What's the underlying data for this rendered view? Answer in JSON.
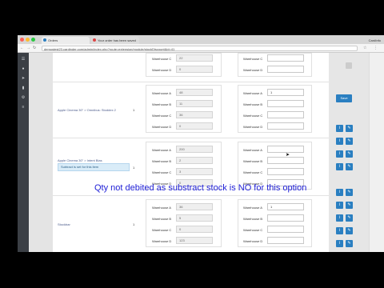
{
  "browser": {
    "tabs": [
      {
        "title": "Orders"
      },
      {
        "title": "Your order has been saved"
      }
    ],
    "user_label": "CardInfo",
    "url": "demostest23.cardinder.com/admin/index.php?route=extension/module/stockDiscount&id=41"
  },
  "sidebar": {
    "icons": [
      "menu-icon",
      "user-icon",
      "share-icon",
      "chart-icon",
      "settings-icon",
      "list-icon"
    ]
  },
  "products": [
    {
      "name": "",
      "qty": "",
      "rows": [
        {
          "label": "Warehouse C",
          "stock": "22",
          "input_label": "Warehouse C",
          "input": ""
        },
        {
          "label": "Warehouse D",
          "stock": "0",
          "input_label": "Warehouse D",
          "input": ""
        }
      ]
    },
    {
      "name": "Apple Cinema 30\" > Omnibus: Stoddex 2",
      "qty": "1",
      "rows": [
        {
          "label": "Warehouse A",
          "stock": "48",
          "input_label": "Warehouse A",
          "input": "1"
        },
        {
          "label": "Warehouse B",
          "stock": "11",
          "input_label": "Warehouse B",
          "input": ""
        },
        {
          "label": "Warehouse C",
          "stock": "36",
          "input_label": "Warehouse C",
          "input": ""
        },
        {
          "label": "Warehouse D",
          "stock": "0",
          "input_label": "Warehouse D",
          "input": ""
        }
      ]
    },
    {
      "name": "Apple Cinema 30\" > Intent Bias",
      "qty": "1",
      "tooltip": "Subtract is set for this item",
      "rows": [
        {
          "label": "Warehouse A",
          "stock": "200",
          "input_label": "Warehouse A",
          "input": ""
        },
        {
          "label": "Warehouse B",
          "stock": "2",
          "input_label": "Warehouse B",
          "input": ""
        },
        {
          "label": "Warehouse C",
          "stock": "3",
          "input_label": "Warehouse C",
          "input": ""
        },
        {
          "label": "Warehouse D",
          "stock": "0",
          "input_label": "Warehouse D",
          "input": ""
        }
      ]
    },
    {
      "name": "Stockbar",
      "qty": "1",
      "rows": [
        {
          "label": "Warehouse A",
          "stock": "36",
          "input_label": "Warehouse A",
          "input": "1"
        },
        {
          "label": "Warehouse B",
          "stock": "5",
          "input_label": "Warehouse B",
          "input": ""
        },
        {
          "label": "Warehouse C",
          "stock": "0",
          "input_label": "Warehouse C",
          "input": ""
        },
        {
          "label": "Warehouse D",
          "stock": "123",
          "input_label": "Warehouse D",
          "input": ""
        }
      ]
    }
  ],
  "right_panel": {
    "button_label": "Save"
  },
  "caption": "Qty not debited as substract stock is NO for this option",
  "colors": {
    "accent": "#2a7fc1",
    "caption": "#1d1dd6",
    "sidebar": "#3b3f45"
  }
}
